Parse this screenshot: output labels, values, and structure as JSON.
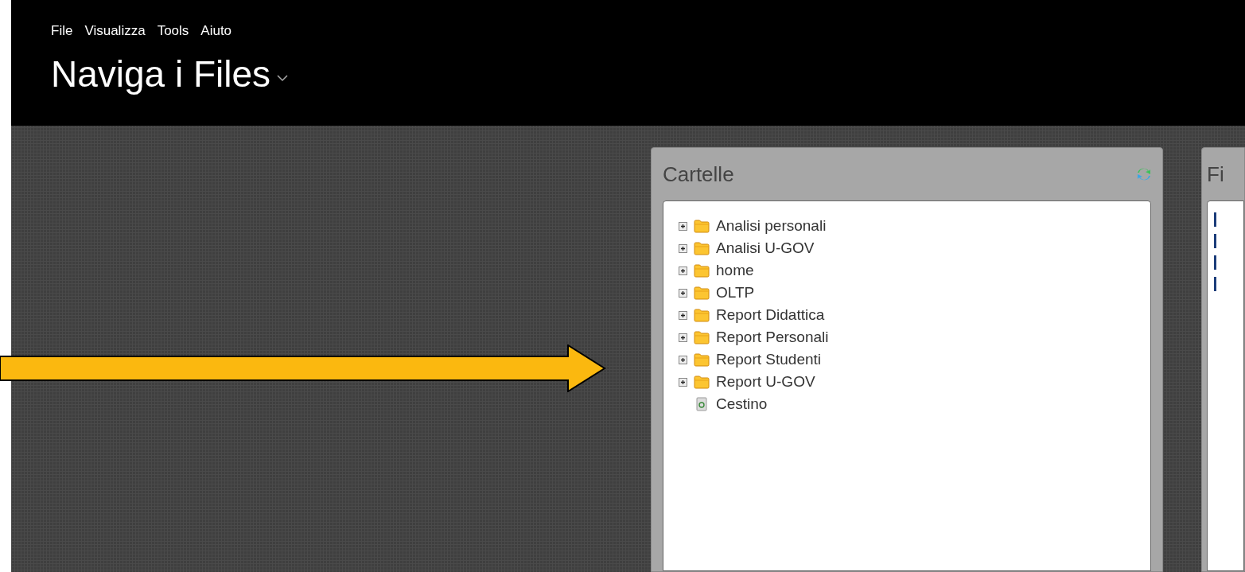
{
  "menu": [
    "File",
    "Visualizza",
    "Tools",
    "Aiuto"
  ],
  "title": "Naviga i Files",
  "folders_panel": {
    "title": "Cartelle",
    "items": [
      {
        "kind": "folder",
        "label": "Analisi personali"
      },
      {
        "kind": "folder",
        "label": "Analisi U-GOV"
      },
      {
        "kind": "folder",
        "label": "home"
      },
      {
        "kind": "folder",
        "label": "OLTP"
      },
      {
        "kind": "folder",
        "label": "Report Didattica"
      },
      {
        "kind": "folder",
        "label": "Report Personali"
      },
      {
        "kind": "folder",
        "label": "Report Studenti"
      },
      {
        "kind": "folder",
        "label": "Report U-GOV"
      },
      {
        "kind": "trash",
        "label": "Cestino"
      }
    ]
  },
  "files_panel": {
    "title": "Fi"
  }
}
